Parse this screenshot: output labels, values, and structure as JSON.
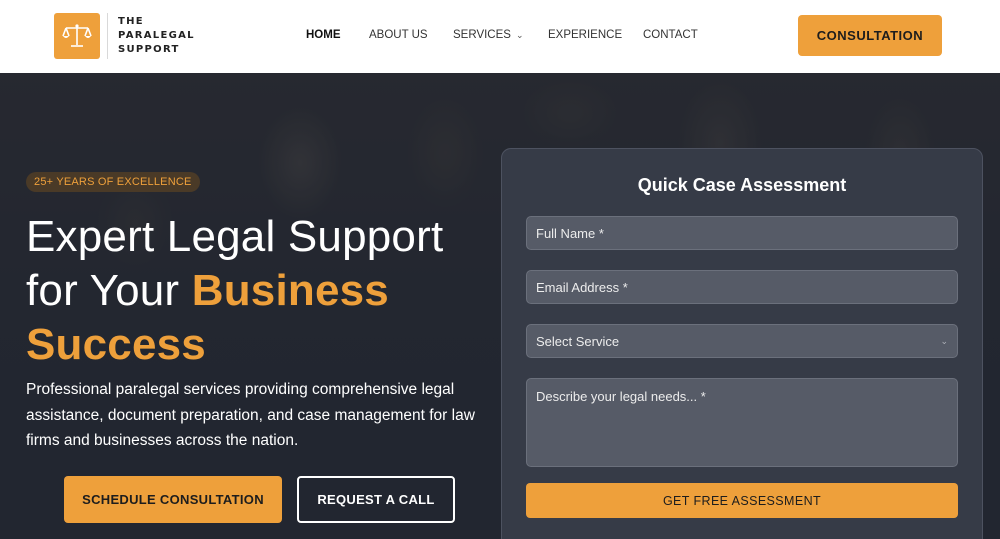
{
  "brand": {
    "line1": "THE",
    "line2": "PARALEGAL",
    "line3": "SUPPORT",
    "accent_color": "#eea03b"
  },
  "nav": {
    "home": "HOME",
    "about": "ABOUT US",
    "services": "SERVICES",
    "experience": "EXPERIENCE",
    "contact": "CONTACT"
  },
  "header": {
    "consultation": "CONSULTATION"
  },
  "hero": {
    "badge": "25+ YEARS OF EXCELLENCE",
    "headline_part1": "Expert Legal Support for Your ",
    "headline_accent": "Business Success",
    "subtext": "Professional paralegal services providing comprehensive legal assistance, document preparation, and case management for law firms and businesses across the nation.",
    "cta_primary": "SCHEDULE CONSULTATION",
    "cta_secondary": "REQUEST A CALL"
  },
  "form": {
    "title": "Quick Case Assessment",
    "full_name": "Full Name *",
    "email": "Email Address *",
    "service": "Select Service",
    "description": "Describe your legal needs... *",
    "submit": "GET FREE ASSESSMENT"
  }
}
